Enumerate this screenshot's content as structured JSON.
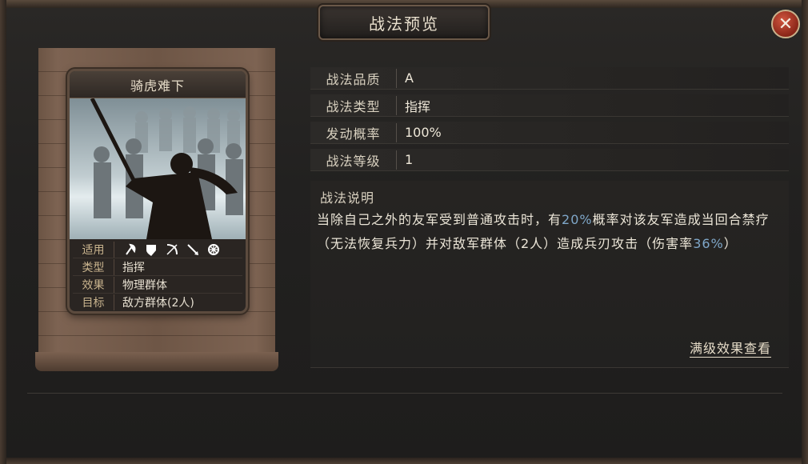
{
  "window": {
    "title": "战法预览"
  },
  "card": {
    "name": "骑虎难下",
    "rows": [
      {
        "key": "适用",
        "icons": [
          "axe-icon",
          "shield-icon",
          "bow-icon",
          "spear-icon",
          "chariot-wheel-icon"
        ]
      },
      {
        "key": "类型",
        "value": "指挥"
      },
      {
        "key": "效果",
        "value": "物理群体"
      },
      {
        "key": "目标",
        "value": "敌方群体(2人)"
      }
    ]
  },
  "info": {
    "quality_label": "战法品质",
    "quality_value": "A",
    "type_label": "战法类型",
    "type_value": "指挥",
    "rate_label": "发动概率",
    "rate_value": "100%",
    "level_label": "战法等级",
    "level_value": "1"
  },
  "description": {
    "label": "战法说明",
    "part1": "当除自己之外的友军受到普通攻击时，有",
    "hl1": "20%",
    "part2": "概率对该友军造成当回合禁疗（无法恢复兵力）并对敌军群体（2人）造成兵刃攻击（伤害率",
    "hl2": "36%",
    "part3": "）"
  },
  "max_level_link": "满级效果查看",
  "colors": {
    "highlight": "#7fa7c9",
    "close": "#b53a26"
  }
}
